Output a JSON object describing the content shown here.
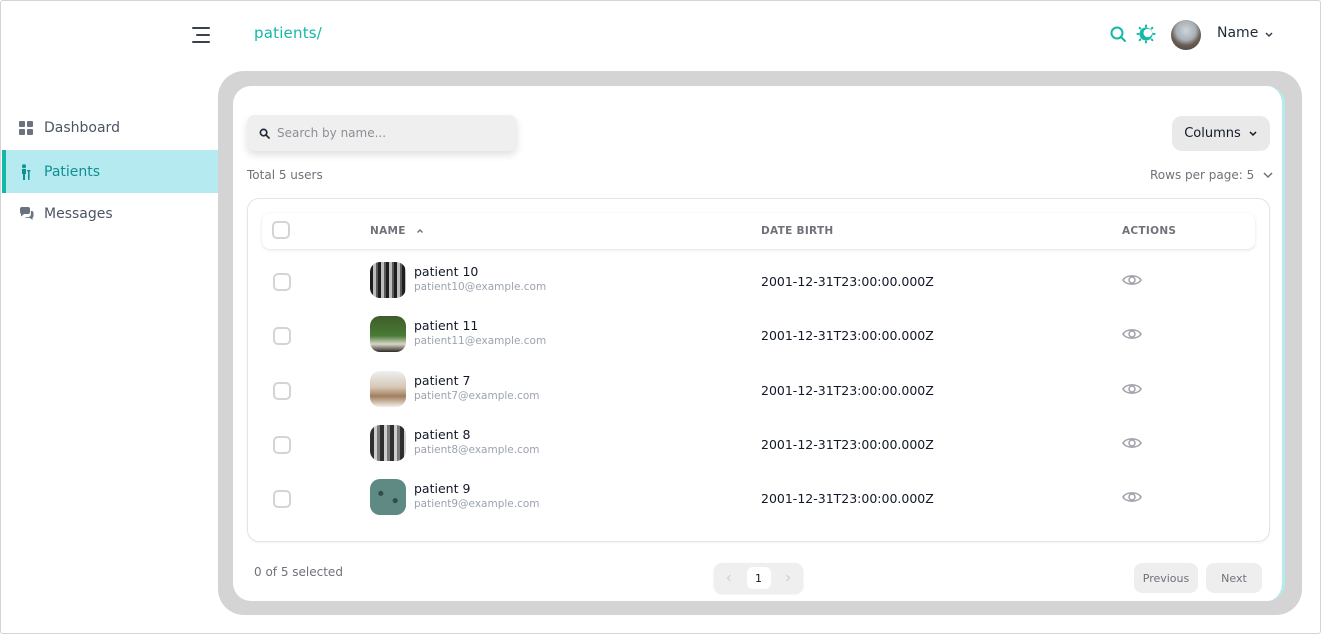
{
  "header": {
    "breadcrumb": "patients/",
    "user_name": "Name"
  },
  "sidebar": {
    "items": [
      {
        "label": "Dashboard",
        "icon": "dashboard-grid-icon",
        "active": false
      },
      {
        "label": "Patients",
        "icon": "patient-person-icon",
        "active": true
      },
      {
        "label": "Messages",
        "icon": "chat-bubbles-icon",
        "active": false
      }
    ]
  },
  "toolbar": {
    "search_placeholder": "Search by name...",
    "search_value": "",
    "columns_label": "Columns",
    "total_label": "Total 5 users",
    "rows_per_page_label": "Rows per page: 5"
  },
  "table": {
    "columns": [
      "NAME",
      "DATE BIRTH",
      "ACTIONS"
    ],
    "sort": {
      "column": "NAME",
      "direction": "ascending"
    },
    "rows": [
      {
        "name": "patient 10",
        "email": "patient10@example.com",
        "date_birth": "2001-12-31T23:00:00.000Z"
      },
      {
        "name": "patient 11",
        "email": "patient11@example.com",
        "date_birth": "2001-12-31T23:00:00.000Z"
      },
      {
        "name": "patient 7",
        "email": "patient7@example.com",
        "date_birth": "2001-12-31T23:00:00.000Z"
      },
      {
        "name": "patient 8",
        "email": "patient8@example.com",
        "date_birth": "2001-12-31T23:00:00.000Z"
      },
      {
        "name": "patient 9",
        "email": "patient9@example.com",
        "date_birth": "2001-12-31T23:00:00.000Z"
      }
    ]
  },
  "footer": {
    "selected_label": "0 of 5 selected",
    "current_page": "1",
    "previous_label": "Previous",
    "next_label": "Next"
  },
  "colors": {
    "accent": "#14b8a6",
    "active_nav_bg": "#b5ebf0",
    "panel_frame": "#d4d4d4"
  }
}
